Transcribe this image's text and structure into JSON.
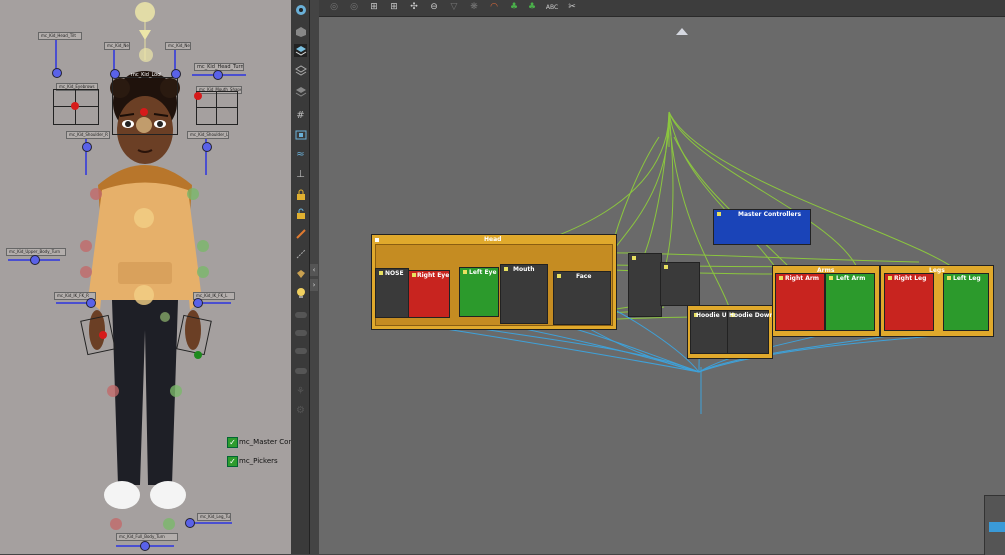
{
  "picker": {
    "labels": {
      "head_tilt": "mc_Kid_Head_Tilt",
      "neck_l": "mc_Kid_Neck",
      "neck_r": "mc_Kid_Neck",
      "look": "mc_Kid_Look",
      "head_turn": "mc_Kid_Head_Turn",
      "eyebrows": "mc_Kid_Eyebrows",
      "mouth_shape": "mc_Kid_Mouth_Shape",
      "shoulder_r": "mc_Kid_Shoulder_R",
      "shoulder_l": "mc_Kid_Shoulder_L",
      "upper_body_turn": "mc_Kid_Upper_Body_Turn",
      "ik_fk_r": "mc_Kid_IK_FK_R",
      "ik_fk_l": "mc_Kid_IK_FK_L",
      "leg_turn": "mc_Kid_Leg_Turn",
      "full_body_turn": "mc_Kid_Full_Body_Turn"
    },
    "toggles": [
      {
        "label": "mc_Master Contr",
        "checked": true
      },
      {
        "label": "mc_Pickers",
        "checked": true
      }
    ]
  },
  "toolstrip": {
    "icons": [
      "eye-icon",
      "cube-icon",
      "layers-icon",
      "stack-icon",
      "stack-outline-icon",
      "grid-icon",
      "frame-icon",
      "wave-icon",
      "align-icon",
      "lock-icon",
      "lock-open-icon",
      "brush-icon",
      "dotted-line-icon",
      "bucket-icon",
      "bulb-icon"
    ]
  },
  "topbar": {
    "icons": [
      "camera-icon",
      "film-icon",
      "hierarchy-icon",
      "hierarchy-down-icon",
      "network-icon",
      "globe-icon",
      "funnel-icon",
      "palette-icon",
      "tree-icon",
      "tree-alt-icon",
      "abc-icon",
      "scissors-icon"
    ],
    "abc_label": "ABC"
  },
  "graph": {
    "groups": {
      "head": "Head",
      "arms": "Arms",
      "legs": "Legs"
    },
    "nodes": {
      "nose": "NOSE",
      "right_eye": "Right Eye",
      "left_eye": "Left Eye",
      "mouth": "Mouth",
      "face": "Face",
      "master": "Master Controllers",
      "hoodie_up": "Hoodie Up",
      "hoodie_down": "Hoodie Down",
      "right_arm": "Right Arm",
      "left_arm": "Left Arm",
      "right_leg": "Right Leg",
      "left_leg": "Left Leg"
    }
  },
  "colors": {
    "picker_bg": "#a5a09f",
    "graph_bg": "#6a6a6a",
    "group_orange": "#e0a92c",
    "node_red": "#c8241f",
    "node_green": "#2c9a2c",
    "node_dark": "#3a3a3a",
    "node_blue": "#1a44b8",
    "wire_green": "#8fd13a",
    "wire_blue": "#3aa8e6"
  }
}
